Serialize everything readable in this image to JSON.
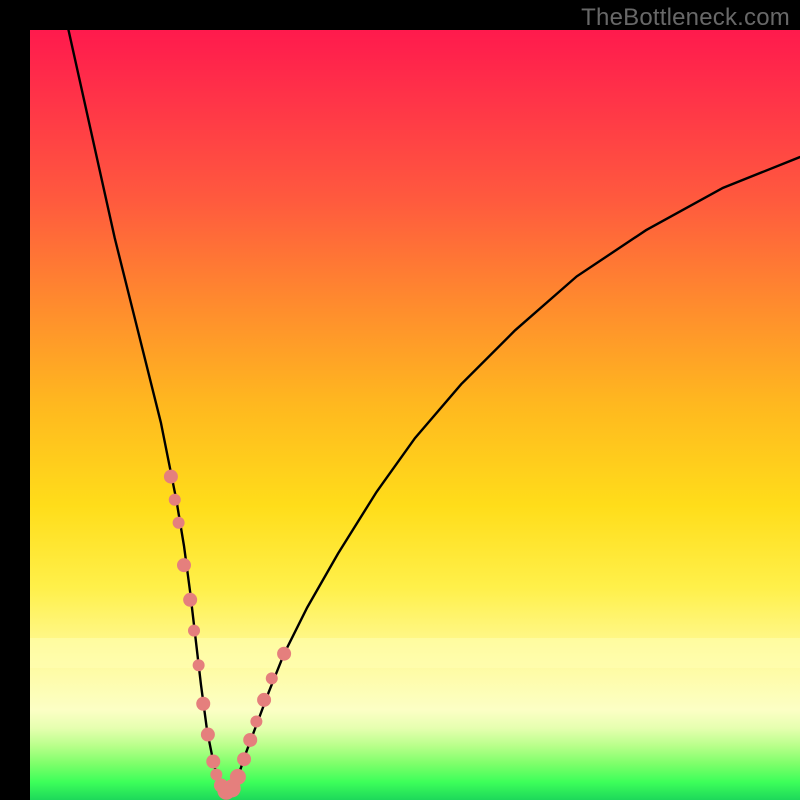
{
  "watermark": "TheBottleneck.com",
  "colors": {
    "background": "#000000",
    "curve": "#000000",
    "nodes": "#e57f7d",
    "watermark": "#686868",
    "gradient_top": "#ff1a4d",
    "gradient_bottom": "#1dd85a"
  },
  "chart_data": {
    "type": "line",
    "title": "",
    "xlabel": "",
    "ylabel": "",
    "xlim": [
      0,
      100
    ],
    "ylim": [
      0,
      100
    ],
    "grid": false,
    "legend": false,
    "series": [
      {
        "name": "bottleneck-curve",
        "x": [
          5,
          7,
          9,
          11,
          13,
          15,
          17,
          18,
          19,
          20,
          20.8,
          21.5,
          22.2,
          23,
          23.8,
          24.5,
          25.3,
          26,
          27,
          28,
          29.5,
          31,
          33,
          36,
          40,
          45,
          50,
          56,
          63,
          71,
          80,
          90,
          100
        ],
        "y": [
          100,
          91,
          82,
          73,
          65,
          57,
          49,
          44,
          39,
          33,
          27,
          21,
          15,
          9,
          5,
          2.2,
          1,
          1.2,
          3,
          6,
          10,
          14,
          19,
          25,
          32,
          40,
          47,
          54,
          61,
          68,
          74,
          79.5,
          83.5
        ]
      }
    ],
    "nodes": {
      "name": "highlight-points",
      "x": [
        18.3,
        18.8,
        19.3,
        20.0,
        20.8,
        21.3,
        21.9,
        22.5,
        23.1,
        23.8,
        24.2,
        24.8,
        25.5,
        26.2,
        27.0,
        27.8,
        28.6,
        29.4,
        30.4,
        31.4,
        33.0
      ],
      "y": [
        42.0,
        39.0,
        36.0,
        30.5,
        26.0,
        22.0,
        17.5,
        12.5,
        8.5,
        5.0,
        3.3,
        1.9,
        1.2,
        1.5,
        3.0,
        5.3,
        7.8,
        10.2,
        13.0,
        15.8,
        19.0
      ],
      "radius": [
        7,
        6,
        6,
        7,
        7,
        6,
        6,
        7,
        7,
        7,
        6,
        7,
        9,
        9,
        8,
        7,
        7,
        6,
        7,
        6,
        7
      ]
    }
  }
}
